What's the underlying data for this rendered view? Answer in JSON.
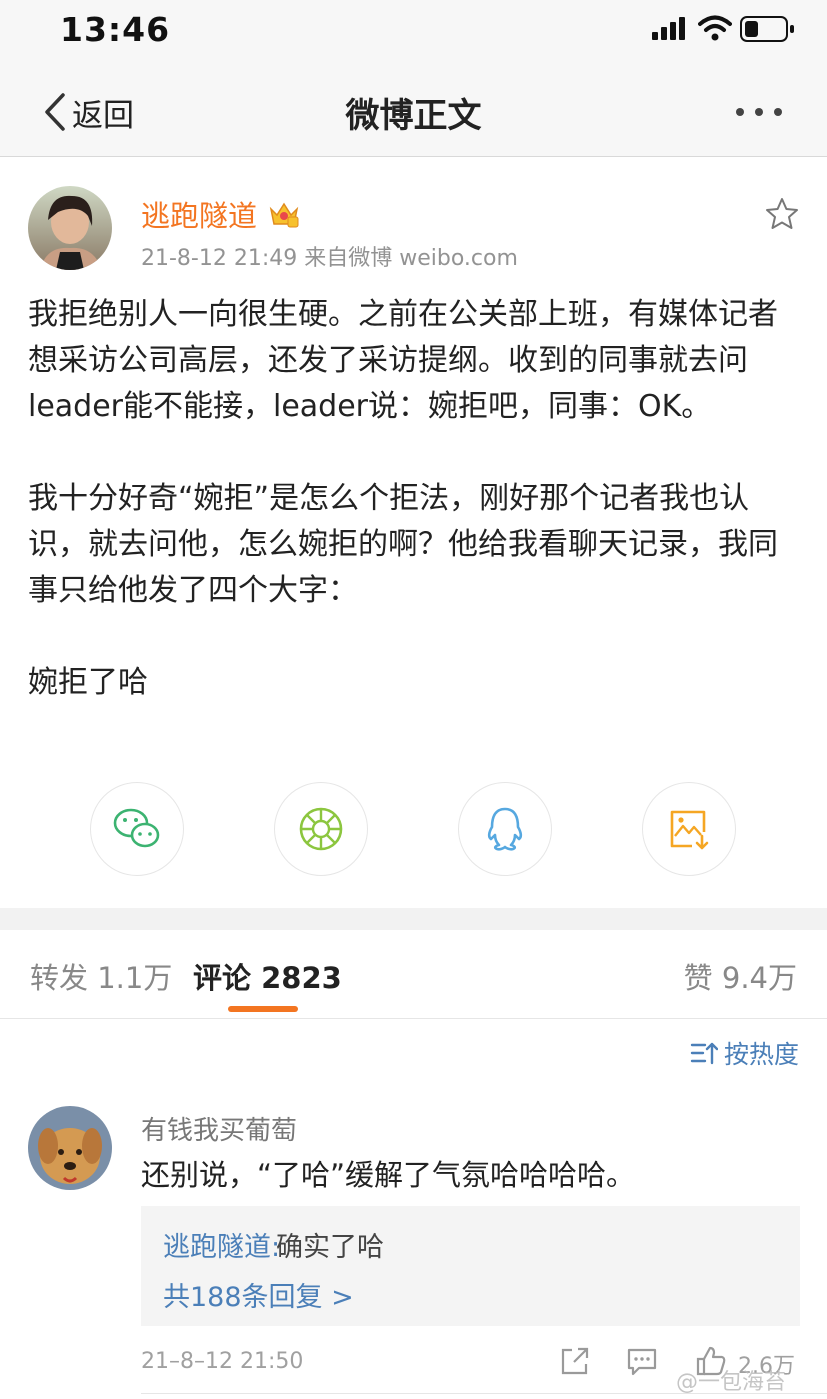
{
  "status_bar": {
    "time": "13:46"
  },
  "nav": {
    "back_label": "返回",
    "title": "微博正文"
  },
  "post": {
    "author": "逃跑隧道",
    "meta": "21-8-12 21:49 来自微博 weibo.com",
    "paragraphs": [
      "我拒绝别人一向很生硬。之前在公关部上班，有媒体记者想采访公司高层，还发了采访提纲。收到的同事就去问leader能不能接，leader说：婉拒吧，同事：OK。",
      "我十分好奇“婉拒”是怎么个拒法，刚好那个记者我也认识，就去问他，怎么婉拒的啊？他给我看聊天记录，我同事只给他发了四个大字：",
      "婉拒了哈"
    ]
  },
  "share": {
    "wechat_color": "#3cb371",
    "moments_color": "#8cc63f",
    "qq_color": "#56a8e0",
    "image_color": "#f5a623"
  },
  "tabs": {
    "repost": "转发 1.1万",
    "comment": "评论 2823",
    "like": "赞 9.4万",
    "accent": "#f37521"
  },
  "sort": {
    "label": "按热度"
  },
  "comment": {
    "username": "有钱我买葡萄",
    "text": "还别说，“了哈”缓解了气氛哈哈哈哈。",
    "reply_author": "逃跑隧道:",
    "reply_text": "确实了哈",
    "reply_more": "共188条回复 >",
    "time": "21–8–12 21:50",
    "likes": "2.6万"
  },
  "watermark": "@一包海苔"
}
